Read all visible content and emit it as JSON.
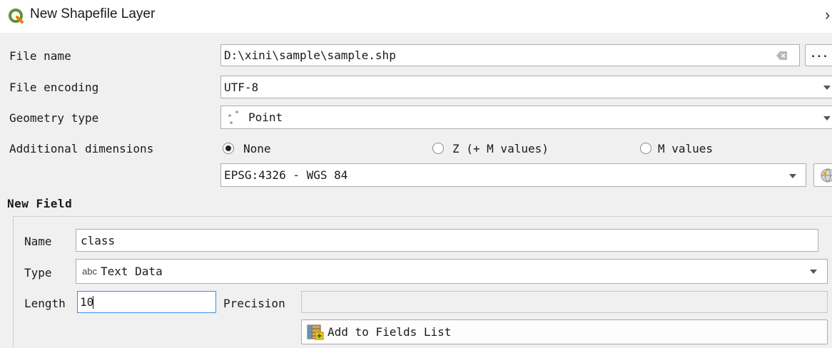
{
  "window": {
    "title": "New Shapefile Layer",
    "close_glyph": "›"
  },
  "form": {
    "file_name_label": "File name",
    "file_name_value": "D:\\xini\\sample\\sample.shp",
    "browse_label": "...",
    "file_encoding_label": "File encoding",
    "file_encoding_value": "UTF-8",
    "geometry_type_label": "Geometry type",
    "geometry_type_value": "Point",
    "additional_dimensions_label": "Additional dimensions",
    "dimension_options": [
      {
        "label": "None",
        "checked": true
      },
      {
        "label": "Z (+ M values)",
        "checked": false
      },
      {
        "label": "M values",
        "checked": false
      }
    ],
    "crs_value": "EPSG:4326 - WGS 84"
  },
  "new_field": {
    "title": "New Field",
    "name_label": "Name",
    "name_value": "class",
    "type_label": "Type",
    "type_badge": "abc",
    "type_value": "Text Data",
    "length_label": "Length",
    "length_value": "10",
    "precision_label": "Precision",
    "precision_value": "",
    "add_button_label": "Add to Fields List"
  },
  "icons": {
    "app_logo": "qgis-logo-icon",
    "clear": "clear-text-icon",
    "point_geometry": "point-geometry-icon",
    "crs_selector": "globe-icon",
    "add_field": "add-field-icon"
  },
  "colors": {
    "logo_green": "#589632",
    "logo_yellow": "#ee7913",
    "focus_border": "#3b8fe0"
  }
}
